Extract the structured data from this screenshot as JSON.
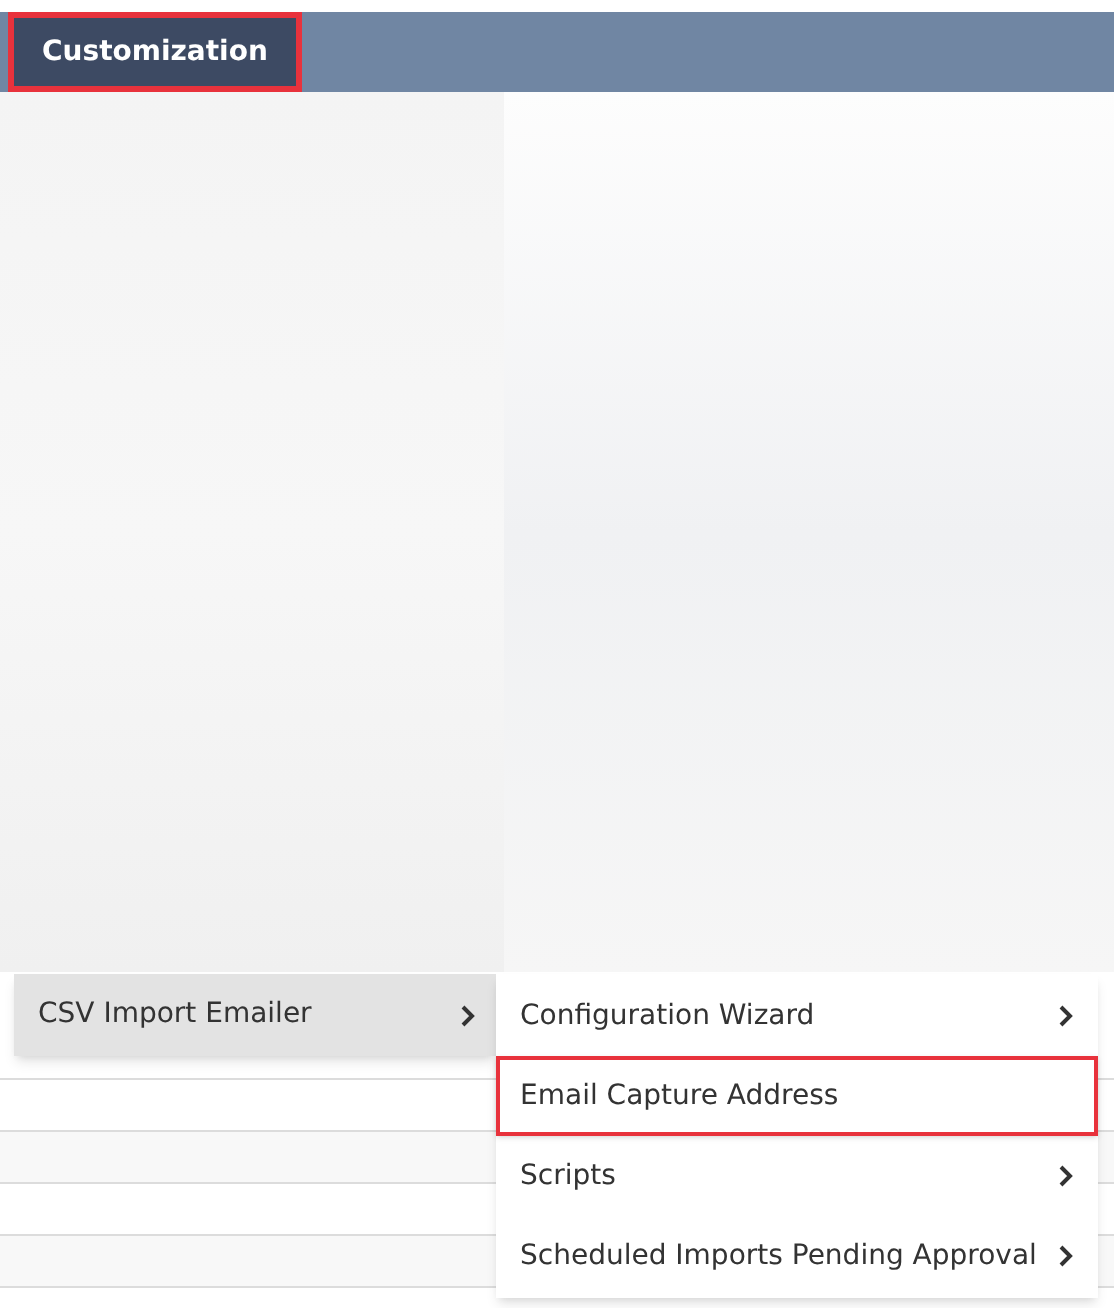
{
  "menu_bar": {
    "tabs": [
      {
        "label": "Customization",
        "selected": true,
        "outlined": true
      }
    ]
  },
  "menu": {
    "items": [
      {
        "label": "CSV Import Emailer",
        "selected": true,
        "has_submenu": true
      }
    ]
  },
  "submenu": {
    "items": [
      {
        "label": "Configuration Wizard",
        "has_submenu": true,
        "outlined": false
      },
      {
        "label": "Email Capture Address",
        "has_submenu": false,
        "outlined": true
      },
      {
        "label": "Scripts",
        "has_submenu": true,
        "outlined": false
      },
      {
        "label": "Scheduled Imports Pending Approval",
        "has_submenu": true,
        "outlined": false
      }
    ]
  }
}
